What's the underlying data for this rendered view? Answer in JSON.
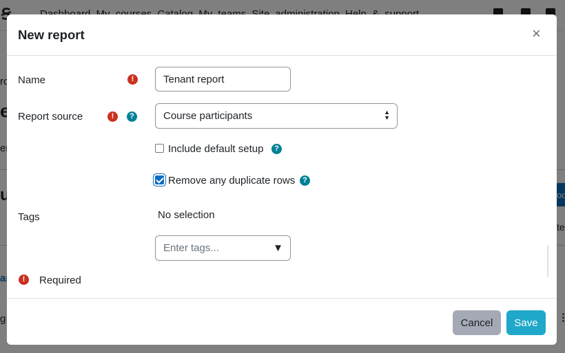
{
  "background": {
    "nav_menu": "Dashboard  My courses  Catalog  My teams  Site administration  Help & support",
    "fragments": [
      "ro",
      "e",
      "er",
      "us",
      "ar",
      "g",
      "oo",
      "te"
    ]
  },
  "modal": {
    "title": "New report",
    "close_symbol": "×",
    "fields": {
      "name": {
        "label": "Name",
        "value": "Tenant report"
      },
      "report_source": {
        "label": "Report source",
        "selected": "Course participants"
      },
      "include_default_setup": {
        "label": "Include default setup",
        "checked": false
      },
      "remove_duplicates": {
        "label": "Remove any duplicate rows",
        "checked": true
      },
      "tags": {
        "label": "Tags",
        "selection_text": "No selection",
        "placeholder": "Enter tags..."
      }
    },
    "required_note": "Required",
    "required_symbol": "!",
    "help_symbol": "?",
    "buttons": {
      "cancel": "Cancel",
      "save": "Save"
    }
  },
  "colors": {
    "required": "#ca3120",
    "help": "#008196",
    "save_button": "#1fa8c9",
    "cancel_button": "#a5a9b5",
    "checkbox_checked": "#0f6cbf"
  },
  "icons": {
    "required": "required-icon",
    "help": "help-icon",
    "close": "close-icon",
    "select": "select-arrows-icon",
    "tags_dropdown": "triangle-down-icon"
  }
}
